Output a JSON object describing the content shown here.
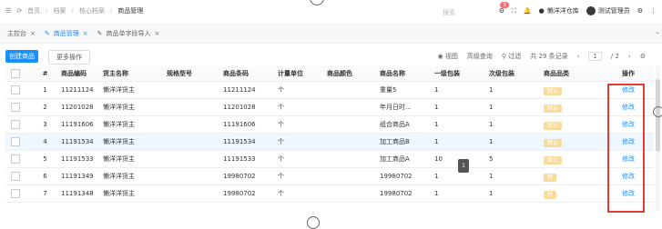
{
  "breadcrumb": {
    "items": [
      "首页",
      "档案",
      "核心档案",
      "商品管理"
    ]
  },
  "search": {
    "placeholder": "搜索"
  },
  "top": {
    "notification_count": "3",
    "warehouse": "懒洋洋仓库",
    "admin": "测试管理员"
  },
  "tabs": [
    {
      "label": "主控台"
    },
    {
      "label": "商品管理"
    },
    {
      "label": "商品单字段导入"
    }
  ],
  "toolbar": {
    "create": "创建商品",
    "more": "更多操作",
    "view": "视图",
    "advanced": "高级查询",
    "filter": "过滤",
    "total": "共 29 条记录",
    "page": "1",
    "pages": "/ 2"
  },
  "table": {
    "headers": [
      "#",
      "商品编码",
      "货主名称",
      "规格型号",
      "商品条码",
      "计量单位",
      "商品颜色",
      "商品名称",
      "一级包装",
      "次级包装",
      "商品品类",
      "操作"
    ],
    "rows": [
      {
        "idx": "1",
        "code": "11211124",
        "owner": "懒洋洋货主",
        "spec": "",
        "barcode": "11211124",
        "unit": "个",
        "color": "",
        "name": "重量5",
        "pack1": "1",
        "pack2": "1",
        "category": "默认",
        "action": "修改"
      },
      {
        "idx": "2",
        "code": "11201028",
        "owner": "懒洋洋货主",
        "spec": "",
        "barcode": "11201028",
        "unit": "个",
        "color": "",
        "name": "年月日时...",
        "pack1": "1",
        "pack2": "1",
        "category": "默认",
        "action": "修改"
      },
      {
        "idx": "3",
        "code": "11191606",
        "owner": "懒洋洋货主",
        "spec": "",
        "barcode": "11191606",
        "unit": "个",
        "color": "",
        "name": "组合商品A",
        "pack1": "1",
        "pack2": "1",
        "category": "默认",
        "action": "修改"
      },
      {
        "idx": "4",
        "code": "11191534",
        "owner": "懒洋洋货主",
        "spec": "",
        "barcode": "11191534",
        "unit": "个",
        "color": "",
        "name": "加工商品B",
        "pack1": "1",
        "pack2": "1",
        "category": "默认",
        "action": "修改"
      },
      {
        "idx": "5",
        "code": "11191533",
        "owner": "懒洋洋货主",
        "spec": "",
        "barcode": "11191533",
        "unit": "个",
        "color": "",
        "name": "加工商品A",
        "pack1": "10",
        "pack2": "5",
        "category": "默认",
        "action": "修改"
      },
      {
        "idx": "6",
        "code": "11191349",
        "owner": "懒洋洋货主",
        "spec": "",
        "barcode": "19980702",
        "unit": "个",
        "color": "",
        "name": "19980702",
        "pack1": "1",
        "pack2": "1",
        "category": "杯",
        "action": "修改"
      },
      {
        "idx": "7",
        "code": "11191348",
        "owner": "懒洋洋货主",
        "spec": "",
        "barcode": "19980702",
        "unit": "个",
        "color": "",
        "name": "19980702",
        "pack1": "1",
        "pack2": "1",
        "category": "杯",
        "action": "修改"
      }
    ]
  },
  "tooltip": "1"
}
